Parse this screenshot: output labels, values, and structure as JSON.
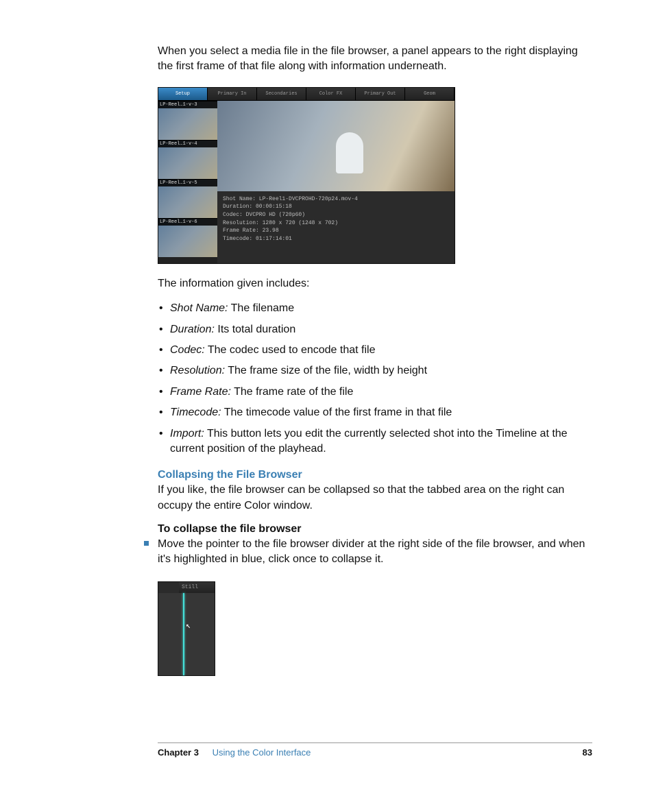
{
  "intro": "When you select a media file in the file browser, a panel appears to the right displaying the first frame of that file along with information underneath.",
  "screenshot1": {
    "tabs": [
      "Setup",
      "Primary In",
      "Secondaries",
      "Color FX",
      "Primary Out",
      "Geom"
    ],
    "thumbs": [
      "LP-Reel…1-v-3",
      "LP-Reel…1-v-4",
      "LP-Reel…1-v-5",
      "LP-Reel…1-v-6"
    ],
    "meta": {
      "l1": "Shot Name: LP-Reel1-DVCPROHD-720p24.mov-4",
      "l2": "Duration: 00:00:15:18",
      "l3": "Codec: DVCPRO HD (720p60)",
      "l4": "Resolution: 1280 x 720 (1248 x 702)",
      "l5": "Frame Rate: 23.98",
      "l6": "Timecode: 01:17:14:01"
    }
  },
  "lead": "The information given includes:",
  "defs": [
    {
      "term": "Shot Name:",
      "desc": "  The filename"
    },
    {
      "term": "Duration:",
      "desc": "  Its total duration"
    },
    {
      "term": "Codec:",
      "desc": "  The codec used to encode that file"
    },
    {
      "term": "Resolution:",
      "desc": "  The frame size of the file, width by height"
    },
    {
      "term": "Frame Rate:",
      "desc": "  The frame rate of the file"
    },
    {
      "term": "Timecode:",
      "desc": "  The timecode value of the first frame in that file"
    },
    {
      "term": "Import:",
      "desc": "  This button lets you edit the currently selected shot into the Timeline at the current position of the playhead."
    }
  ],
  "h_collapse": "Collapsing the File Browser",
  "p_collapse": "If you like, the file browser can be collapsed so that the tabbed area on the right can occupy the entire Color window.",
  "h_tocollapse": "To collapse the file browser",
  "step": "Move the pointer to the file browser divider at the right side of the file browser, and when it's highlighted in blue, click once to collapse it.",
  "screenshot2": {
    "tab": "Still"
  },
  "footer": {
    "chapter": "Chapter 3",
    "title": "Using the Color Interface",
    "page": "83"
  }
}
